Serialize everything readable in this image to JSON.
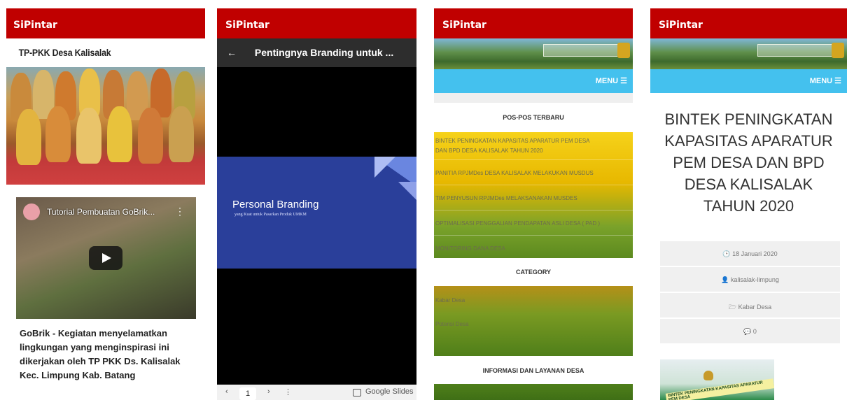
{
  "screens": [
    {
      "app_title": "SiPintar",
      "subtitle": "TP-PKK Desa Kalisalak",
      "video_title": "Tutorial Pembuatan GoBrik...",
      "caption": "GoBrik - Kegiatan menyelamatkan lingkungan yang menginspirasi ini dikerjakan oleh TP PKK Ds. Kalisalak Kec. Limpung Kab. Batang"
    },
    {
      "app_title": "SiPintar",
      "back_icon": "←",
      "page_title": "Pentingnya Branding untuk ...",
      "slide_title": "Personal Branding",
      "slide_subtitle": "yang Kuat untuk Pasarkan Produk UMKM",
      "page_number": "1",
      "footer_brand": "Google Slides"
    },
    {
      "app_title": "SiPintar",
      "menu_label": "MENU ☰",
      "recent_heading": "POS-POS TERBARU",
      "recent_posts": [
        "BINTEK PENINGKATAN KAPASITAS APARATUR PEM DESA",
        "DAN BPD DESA KALISALAK TAHUN 2020",
        "PANITIA RPJMDes DESA KALISALAK MELAKUKAN MUSDUS",
        "TIM PENYUSUN RPJMDes MELAKSANAKAN MUSDES",
        "OPTIMALISASI PENGGALIAN PENDAPATAN ASLI DESA ( PAD )",
        "MONITORING DANA DESA"
      ],
      "category_heading": "CATEGORY",
      "categories": [
        "Kabar Desa",
        "Potensi Desa"
      ],
      "info_heading": "INFORMASI DAN LAYANAN DESA"
    },
    {
      "app_title": "SiPintar",
      "menu_label": "MENU ☰",
      "post_title": "BINTEK PENINGKATAN KAPASITAS APARATUR PEM DESA DAN BPD DESA KALISALAK TAHUN 2020",
      "date": "🕒 18 Januari 2020",
      "author": "👤 kalisalak-limpung",
      "category": "🗁 Kabar Desa",
      "comments": "💬 0",
      "photo_label": "BINTEK PENINGKATAN KAPASITAS APARATUR PEM DESA"
    }
  ]
}
